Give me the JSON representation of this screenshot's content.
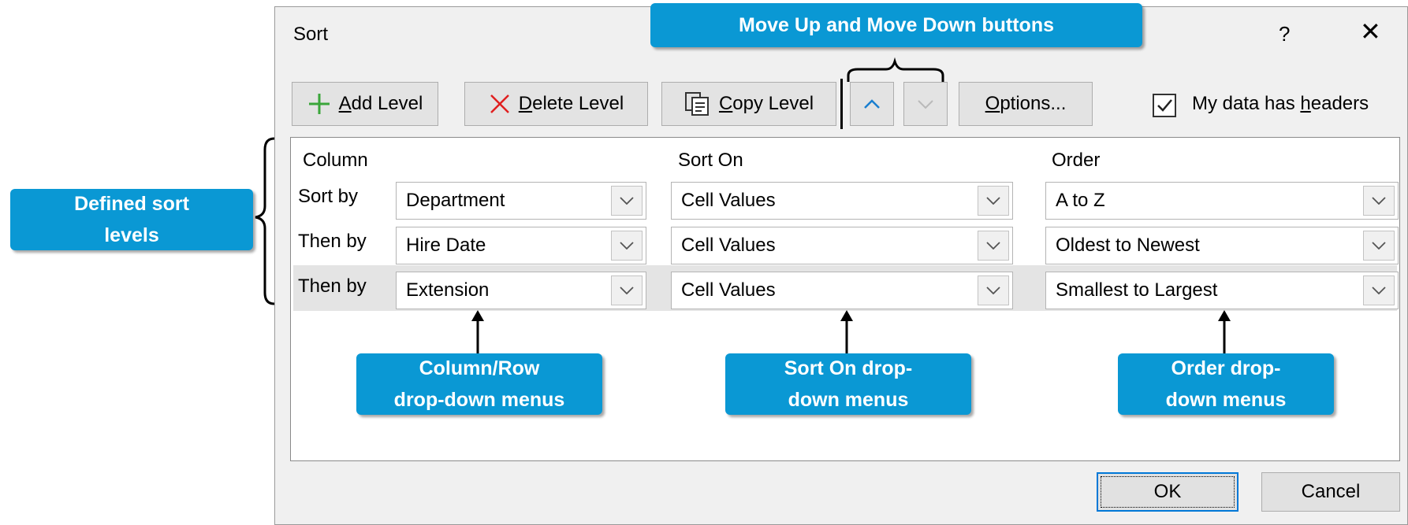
{
  "dialog": {
    "title": "Sort",
    "help_label": "?",
    "close_label": "✕"
  },
  "toolbar": {
    "add_level": {
      "mnemonic": "A",
      "rest": "dd Level"
    },
    "delete_level": {
      "mnemonic": "D",
      "rest": "elete Level"
    },
    "copy_level": {
      "mnemonic": "C",
      "rest": "opy Level"
    },
    "options": {
      "mnemonic": "O",
      "rest": "ptions..."
    },
    "headers_checkbox": {
      "pre": "My data has ",
      "mnemonic": "h",
      "post": "eaders",
      "checked": true
    }
  },
  "grid": {
    "columns": [
      "Column",
      "Sort On",
      "Order"
    ],
    "rows": [
      {
        "label": "Sort by",
        "column": "Department",
        "sort_on": "Cell Values",
        "order": "A to Z"
      },
      {
        "label": "Then by",
        "column": "Hire Date",
        "sort_on": "Cell Values",
        "order": "Oldest to Newest"
      },
      {
        "label": "Then by",
        "column": "Extension",
        "sort_on": "Cell Values",
        "order": "Smallest to Largest"
      }
    ],
    "selected_row": 2
  },
  "footer": {
    "ok_label": "OK",
    "cancel_label": "Cancel"
  },
  "callouts": {
    "move_buttons": "Move Up and Move Down buttons",
    "sort_levels": [
      "Defined sort",
      "levels"
    ],
    "column_menus": [
      "Column/Row",
      "drop-down menus"
    ],
    "sort_on_menus": [
      "Sort On drop-",
      "down menus"
    ],
    "order_menus": [
      "Order drop-",
      "down menus"
    ]
  },
  "colors": {
    "callout_blue": "#0a98d4",
    "add_icon": "#3aa63a",
    "delete_icon": "#e02020",
    "ok_border": "#0078d7"
  }
}
